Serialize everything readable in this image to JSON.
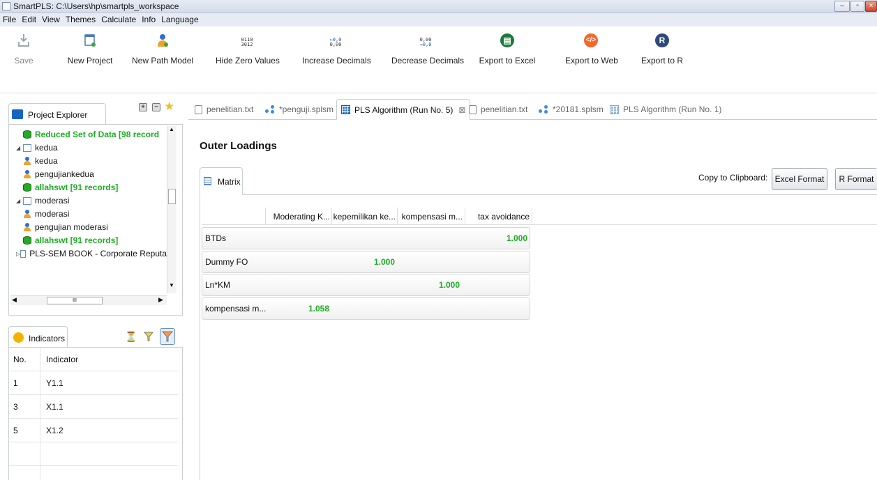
{
  "window": {
    "title": "SmartPLS: C:\\Users\\hp\\smartpls_workspace"
  },
  "menu": [
    "File",
    "Edit",
    "View",
    "Themes",
    "Calculate",
    "Info",
    "Language"
  ],
  "toolbar": {
    "save": "Save",
    "new_project": "New Project",
    "new_path_model": "New Path Model",
    "hide_zero": "Hide Zero Values",
    "hide_zero_icon_top": "0110",
    "hide_zero_icon_bottom": "3012",
    "increase_decimals": "Increase Decimals",
    "increase_icon_top": "←0,0",
    "increase_icon_bottom": "0,00",
    "decrease_decimals": "Decrease Decimals",
    "decrease_icon_top": "0,00",
    "decrease_icon_bottom": "→0,0",
    "export_excel": "Export to Excel",
    "export_web": "Export to Web",
    "export_r": "Export to R",
    "export_r_glyph": "R",
    "colors": {
      "excel": "#1e7a3c",
      "web": "#ef6a2c",
      "r": "#2e4a7a"
    }
  },
  "project_explorer": {
    "tab_label": "Project Explorer",
    "items": [
      {
        "label": "Reduced Set of Data [98 record",
        "type": "data",
        "indent": 2
      },
      {
        "label": "kedua",
        "type": "project",
        "indent": 0,
        "expanded": true
      },
      {
        "label": "kedua",
        "type": "model",
        "indent": 2
      },
      {
        "label": "pengujiankedua",
        "type": "model",
        "indent": 2
      },
      {
        "label": "allahswt [91 records]",
        "type": "data",
        "indent": 2
      },
      {
        "label": "moderasi",
        "type": "project",
        "indent": 0,
        "expanded": true
      },
      {
        "label": "moderasi",
        "type": "model",
        "indent": 2
      },
      {
        "label": "pengujian moderasi",
        "type": "model",
        "indent": 2
      },
      {
        "label": "allahswt [91 records]",
        "type": "data",
        "indent": 2
      },
      {
        "label": "PLS-SEM BOOK - Corporate Reputati",
        "type": "project",
        "indent": 0,
        "expanded": false
      }
    ],
    "scroll_glyph": "III"
  },
  "indicators": {
    "tab_label": "Indicators",
    "columns": [
      "No.",
      "Indicator"
    ],
    "rows": [
      {
        "no": "1",
        "indicator": "Y1.1"
      },
      {
        "no": "3",
        "indicator": "X1.1"
      },
      {
        "no": "5",
        "indicator": "X1.2"
      }
    ]
  },
  "editor_tabs": [
    {
      "label": "penelitian.txt",
      "icon": "document-icon",
      "active": false
    },
    {
      "label": "*penguji.splsm",
      "icon": "model-icon",
      "active": false
    },
    {
      "label": "PLS Algorithm (Run No. 5)",
      "icon": "report-icon",
      "active": true
    },
    {
      "label": "penelitian.txt",
      "icon": "document-icon",
      "active": false
    },
    {
      "label": "*20181.splsm",
      "icon": "model-icon",
      "active": false
    },
    {
      "label": "PLS Algorithm (Run No. 1)",
      "icon": "report-icon",
      "active": false
    }
  ],
  "tab_close_glyph": "⊠",
  "report": {
    "title": "Outer Loadings",
    "subtab": "Matrix",
    "copy_label": "Copy to Clipboard:",
    "excel_format": "Excel Format",
    "r_format": "R Format",
    "columns": [
      "Moderating K...",
      "kepemilikan ke...",
      "kompensasi m...",
      "tax avoidance"
    ],
    "rows": [
      {
        "label": "BTDs",
        "col": 3,
        "value": "1.000"
      },
      {
        "label": "Dummy FO",
        "col": 1,
        "value": "1.000"
      },
      {
        "label": "Ln*KM",
        "col": 2,
        "value": "1.000"
      },
      {
        "label": "kompensasi m...",
        "col": 0,
        "value": "1.058"
      }
    ]
  }
}
